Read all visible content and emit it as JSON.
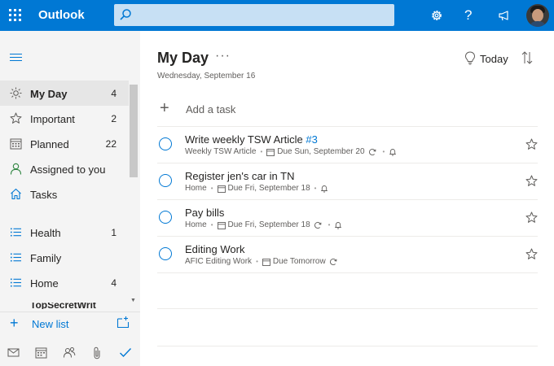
{
  "topbar": {
    "brand": "Outlook",
    "search_placeholder": "",
    "help_label": "?"
  },
  "sidebar": {
    "items": [
      {
        "icon": "sun-icon",
        "label": "My Day",
        "count": "4"
      },
      {
        "icon": "star-icon",
        "label": "Important",
        "count": "2"
      },
      {
        "icon": "calendar-icon",
        "label": "Planned",
        "count": "22"
      },
      {
        "icon": "person-icon",
        "label": "Assigned to you",
        "count": ""
      },
      {
        "icon": "home-icon",
        "label": "Tasks",
        "count": ""
      },
      {
        "icon": "list-icon",
        "label": "Health",
        "count": "1"
      },
      {
        "icon": "list-icon",
        "label": "Family",
        "count": ""
      },
      {
        "icon": "list-icon",
        "label": "Home",
        "count": "4"
      }
    ],
    "truncated_item": "TopSecretWrit",
    "new_list_label": "New list"
  },
  "main": {
    "title": "My Day",
    "more_label": "···",
    "date": "Wednesday, September 16",
    "today_label": "Today",
    "add_task_label": "Add a task",
    "tasks": [
      {
        "title": "Write weekly TSW Article",
        "tag": "#3",
        "list": "Weekly TSW Article",
        "due": "Due Sun, September 20",
        "repeat": true,
        "reminder": true
      },
      {
        "title": "Register jen's car in TN",
        "tag": "",
        "list": "Home",
        "due": "Due Fri, September 18",
        "repeat": false,
        "reminder": true
      },
      {
        "title": "Pay bills",
        "tag": "",
        "list": "Home",
        "due": "Due Fri, September 18",
        "repeat": true,
        "reminder": true
      },
      {
        "title": "Editing Work",
        "tag": "",
        "list": "AFIC Editing Work",
        "due": "Due Tomorrow",
        "repeat": true,
        "reminder": false
      }
    ]
  },
  "colors": {
    "accent": "#0078d4",
    "sidebar_bg": "#f4f4f4",
    "active_bg": "#e6e6e6",
    "text": "#252423",
    "muted": "#605e5c"
  }
}
